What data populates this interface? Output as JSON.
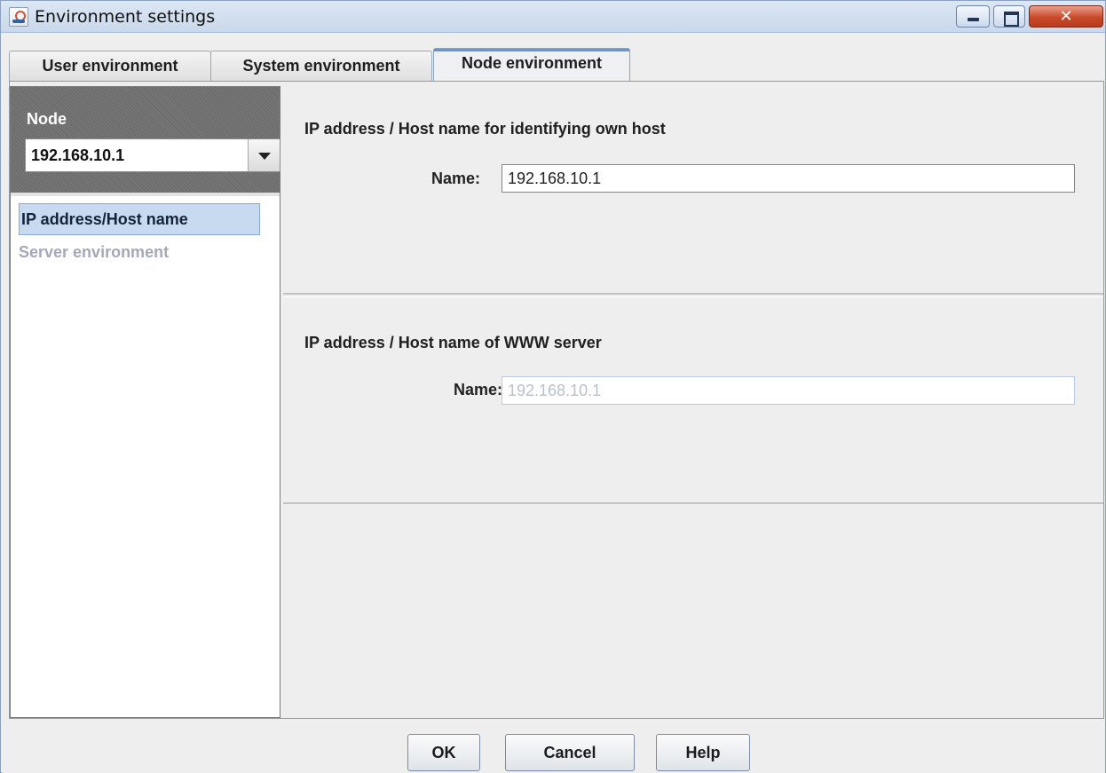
{
  "window": {
    "title": "Environment settings"
  },
  "tabs": [
    {
      "label": "User environment",
      "active": false
    },
    {
      "label": "System environment",
      "active": false
    },
    {
      "label": "Node environment",
      "active": true
    }
  ],
  "left_panel": {
    "node_label": "Node",
    "node_value": "192.168.10.1",
    "items": [
      {
        "label": "IP address/Host name",
        "selected": true,
        "enabled": true
      },
      {
        "label": "Server environment",
        "selected": false,
        "enabled": false
      }
    ]
  },
  "own_host": {
    "title": "IP address / Host name for identifying own host",
    "name_label": "Name:",
    "name_value": "192.168.10.1"
  },
  "www_server": {
    "title": "IP address / Host name of WWW server",
    "name_label": "Name:",
    "name_value": "192.168.10.1",
    "enabled": false
  },
  "buttons": {
    "ok": "OK",
    "cancel": "Cancel",
    "help": "Help"
  },
  "colors": {
    "selection": "#c8daf0",
    "disabled_text": "#a5a8b8",
    "close_button": "#c94a2b"
  }
}
